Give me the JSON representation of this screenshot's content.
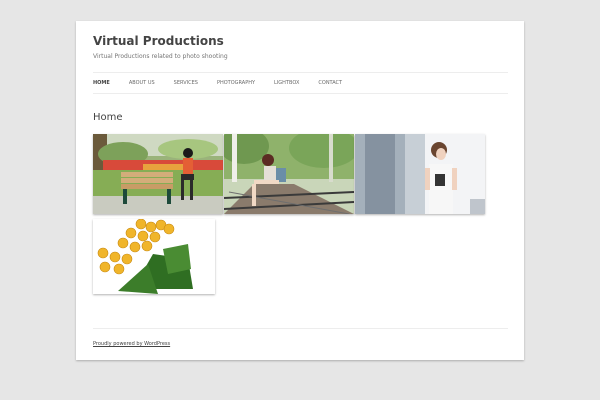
{
  "site": {
    "title": "Virtual Productions",
    "description": "Virtual Productions related to photo shooting"
  },
  "nav": {
    "items": [
      {
        "label": "Home",
        "active": true
      },
      {
        "label": "About Us",
        "active": false
      },
      {
        "label": "Services",
        "active": false
      },
      {
        "label": "Photography",
        "active": false
      },
      {
        "label": "Lightbox",
        "active": false
      },
      {
        "label": "Contact",
        "active": false
      }
    ]
  },
  "page": {
    "heading": "Home"
  },
  "gallery": {
    "images": [
      {
        "name": "woman-on-bench-photo"
      },
      {
        "name": "woman-on-railway-photo"
      },
      {
        "name": "woman-by-building-photo"
      },
      {
        "name": "yellow-roses-photo"
      }
    ]
  },
  "footer": {
    "credit": "Proudly powered by WordPress"
  },
  "colors": {
    "background": "#e6e6e6",
    "page": "#ffffff",
    "text": "#444444"
  }
}
